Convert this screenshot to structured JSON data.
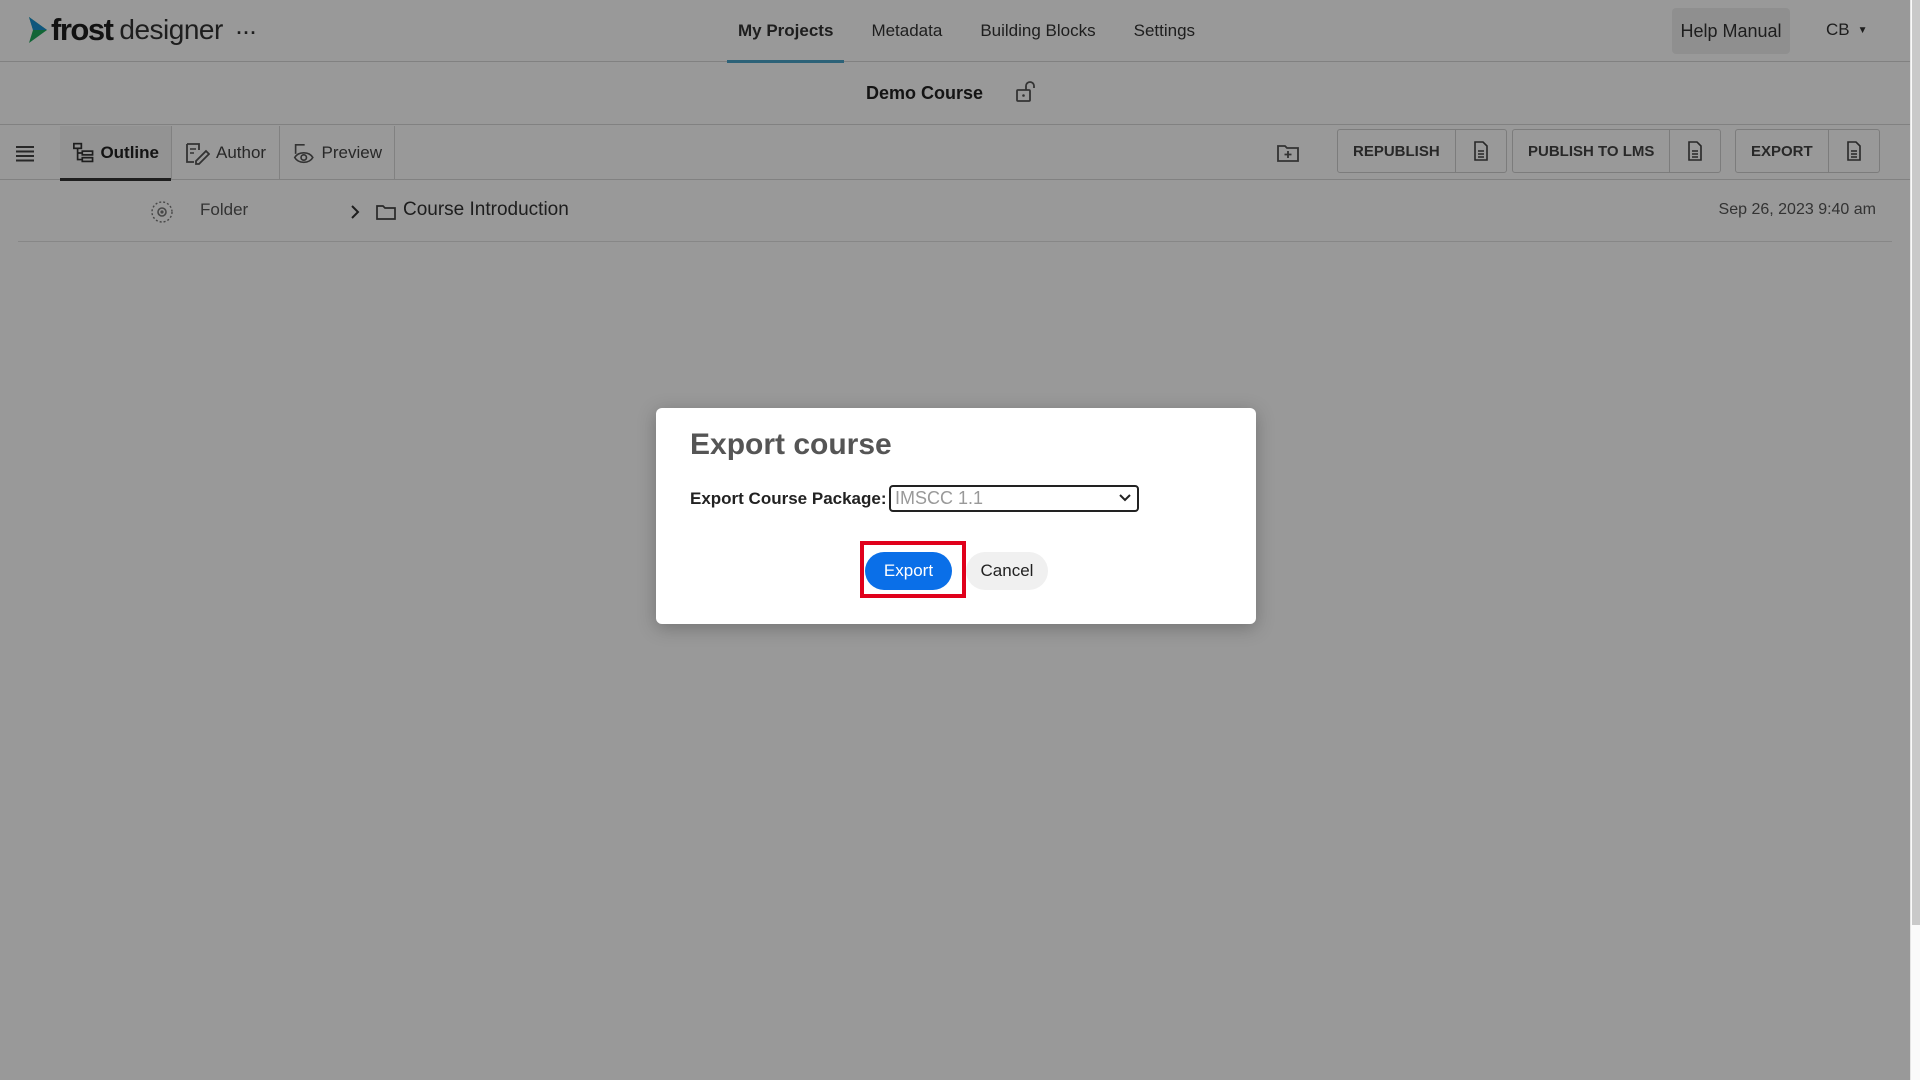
{
  "header": {
    "logo_brand": "frost",
    "logo_product": "designer",
    "more_label": "···",
    "nav": [
      {
        "label": "My Projects"
      },
      {
        "label": "Metadata"
      },
      {
        "label": "Building Blocks"
      },
      {
        "label": "Settings"
      }
    ],
    "help_label": "Help Manual",
    "user_initials": "CB"
  },
  "course": {
    "title": "Demo Course"
  },
  "toolbar": {
    "views": [
      {
        "label": "Outline",
        "icon": "outline-tree-icon"
      },
      {
        "label": "Author",
        "icon": "author-edit-icon"
      },
      {
        "label": "Preview",
        "icon": "preview-eye-icon"
      }
    ],
    "republish_label": "REPUBLISH",
    "publish_lms_label": "PUBLISH TO LMS",
    "export_label": "EXPORT"
  },
  "outline": {
    "rows": [
      {
        "type": "Folder",
        "name": "Course Introduction",
        "date": "Sep 26, 2023 9:40 am"
      }
    ]
  },
  "dialog": {
    "title": "Export course",
    "field_label": "Export Course Package:",
    "selected_package": "IMSCC 1.1",
    "export_label": "Export",
    "cancel_label": "Cancel"
  },
  "colors": {
    "accent": "#0a6fe8",
    "nav_underline": "#4aa3c9",
    "highlight": "#e0001b",
    "logo_green": "#1fa85a"
  }
}
